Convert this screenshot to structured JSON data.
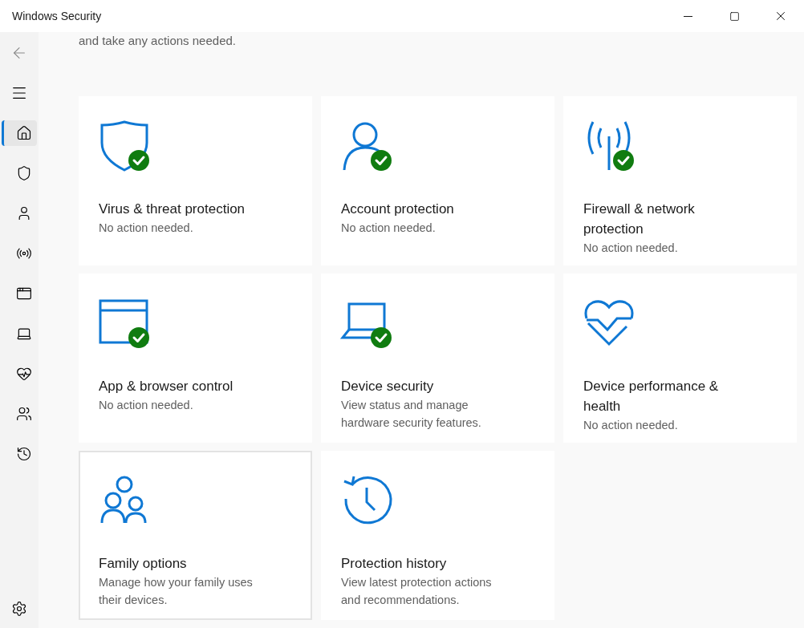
{
  "window": {
    "title": "Windows Security"
  },
  "sidebar": {
    "items": [
      {
        "kind": "home",
        "selected": true
      },
      {
        "kind": "shield",
        "selected": false
      },
      {
        "kind": "person",
        "selected": false
      },
      {
        "kind": "antenna",
        "selected": false
      },
      {
        "kind": "window",
        "selected": false
      },
      {
        "kind": "laptop",
        "selected": false
      },
      {
        "kind": "heart",
        "selected": false
      },
      {
        "kind": "family",
        "selected": false
      },
      {
        "kind": "history",
        "selected": false
      }
    ]
  },
  "intro": "and take any actions needed.",
  "cards": [
    {
      "kind": "shield",
      "title": "Virus & threat protection",
      "status": "No action needed.",
      "ok": true,
      "selected": false
    },
    {
      "kind": "person",
      "title": "Account protection",
      "status": "No action needed.",
      "ok": true,
      "selected": false
    },
    {
      "kind": "antenna",
      "title": "Firewall & network protection",
      "status": "No action needed.",
      "ok": true,
      "selected": false
    },
    {
      "kind": "window",
      "title": "App & browser control",
      "status": "No action needed.",
      "ok": true,
      "selected": false
    },
    {
      "kind": "laptop",
      "title": "Device security",
      "status": "View status and manage hardware security features.",
      "ok": true,
      "selected": false
    },
    {
      "kind": "heart",
      "title": "Device performance & health",
      "status": "No action needed.",
      "ok": false,
      "selected": false
    },
    {
      "kind": "family",
      "title": "Family options",
      "status": "Manage how your family uses their devices.",
      "ok": false,
      "selected": true
    },
    {
      "kind": "history",
      "title": "Protection history",
      "status": "View latest protection actions and recommendations.",
      "ok": false,
      "selected": false
    }
  ]
}
